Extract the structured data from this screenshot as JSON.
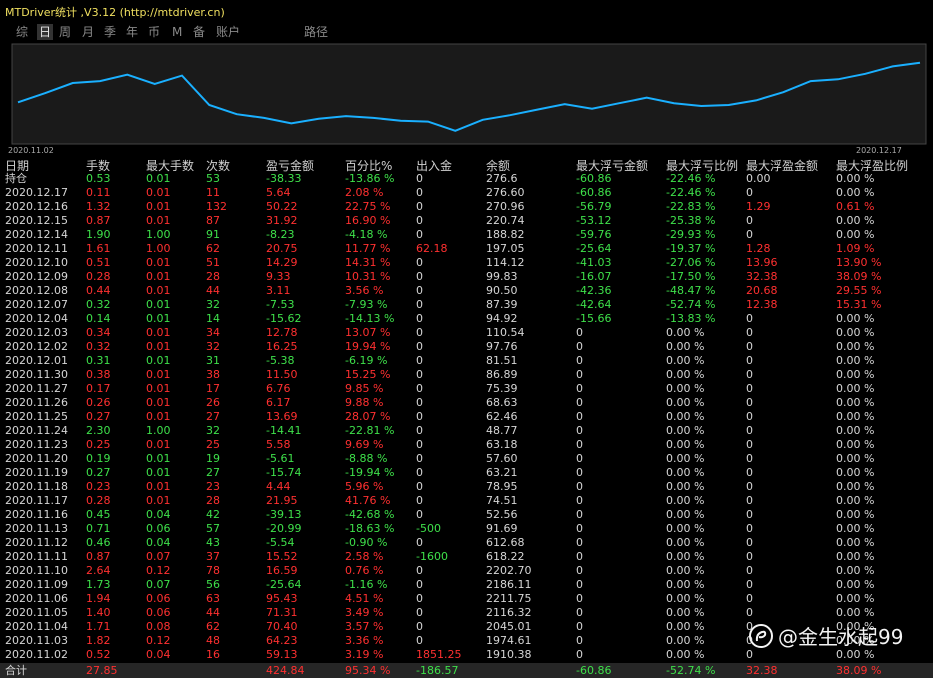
{
  "window": {
    "title": "MTDriver统计 ,V3.12 (http://mtdriver.cn)"
  },
  "tabs": [
    {
      "label": "综",
      "active": false
    },
    {
      "label": "日",
      "active": true
    },
    {
      "label": "周",
      "active": false
    },
    {
      "label": "月",
      "active": false
    },
    {
      "label": "季",
      "active": false
    },
    {
      "label": "年",
      "active": false
    },
    {
      "label": "币",
      "active": false
    },
    {
      "label": "M",
      "active": false
    },
    {
      "label": "备",
      "active": false
    },
    {
      "label": "账户",
      "active": false
    },
    {
      "label": "路径",
      "active": false
    }
  ],
  "chart": {
    "start_label": "2020.11.02",
    "end_label": "2020.12.17",
    "line_color": "#1ab0ff",
    "chart_data": {
      "type": "line",
      "x": [
        "2020.11.02",
        "2020.11.03",
        "2020.11.04",
        "2020.11.05",
        "2020.11.06",
        "2020.11.09",
        "2020.11.10",
        "2020.11.11",
        "2020.11.12",
        "2020.11.13",
        "2020.11.16",
        "2020.11.17",
        "2020.11.18",
        "2020.11.19",
        "2020.11.20",
        "2020.11.23",
        "2020.11.24",
        "2020.11.25",
        "2020.11.26",
        "2020.11.27",
        "2020.11.30",
        "2020.12.01",
        "2020.12.02",
        "2020.12.03",
        "2020.12.04",
        "2020.12.07",
        "2020.12.08",
        "2020.12.09",
        "2020.12.10",
        "2020.12.11",
        "2020.12.14",
        "2020.12.15",
        "2020.12.16",
        "2020.12.17"
      ],
      "y": [
        1910.38,
        1974.61,
        2045.01,
        2116.32,
        2211.75,
        2186.11,
        2202.7,
        618.22,
        612.68,
        91.69,
        52.56,
        74.51,
        78.95,
        63.21,
        57.6,
        63.18,
        48.77,
        62.46,
        68.63,
        75.39,
        86.89,
        81.51,
        97.76,
        110.54,
        94.92,
        87.39,
        90.5,
        99.83,
        114.12,
        197.05,
        188.82,
        220.74,
        270.96,
        276.6
      ]
    },
    "display_values": [
      41,
      51,
      62,
      64,
      71,
      61,
      70,
      38,
      28,
      24,
      18,
      23,
      26,
      24,
      21,
      20,
      10,
      22,
      27,
      33,
      39,
      34,
      40,
      46,
      40,
      37,
      38,
      43,
      52,
      64,
      66,
      72,
      80,
      84
    ]
  },
  "table": {
    "headers": [
      "日期",
      "手数",
      "最大手数",
      "次数",
      "盈亏金额",
      "百分比%",
      "出入金",
      "余额",
      "最大浮亏金额",
      "最大浮亏比例",
      "最大浮盈金额",
      "最大浮盈比例"
    ],
    "position_row": {
      "date": "持仓",
      "lots": "0.53",
      "maxlots": "0.01",
      "count": "53",
      "pl": "-38.33",
      "pct": "-13.86 %",
      "flow": "0",
      "balance": "276.6",
      "maxloss": "-60.86",
      "maxlosspct": "-22.46 %",
      "maxprofit": "0.00",
      "maxprofitpct": "0.00 %"
    },
    "rows": [
      {
        "date": "2020.12.17",
        "lots": "0.11",
        "maxlots": "0.01",
        "count": "11",
        "pl": "5.64",
        "pct": "2.08 %",
        "flow": "0",
        "balance": "276.60",
        "maxloss": "-60.86",
        "maxlosspct": "-22.46 %",
        "maxprofit": "0",
        "maxprofitpct": "0.00 %"
      },
      {
        "date": "2020.12.16",
        "lots": "1.32",
        "maxlots": "0.01",
        "count": "132",
        "pl": "50.22",
        "pct": "22.75 %",
        "flow": "0",
        "balance": "270.96",
        "maxloss": "-56.79",
        "maxlosspct": "-22.83 %",
        "maxprofit": "1.29",
        "maxprofitpct": "0.61 %"
      },
      {
        "date": "2020.12.15",
        "lots": "0.87",
        "maxlots": "0.01",
        "count": "87",
        "pl": "31.92",
        "pct": "16.90 %",
        "flow": "0",
        "balance": "220.74",
        "maxloss": "-53.12",
        "maxlosspct": "-25.38 %",
        "maxprofit": "0",
        "maxprofitpct": "0.00 %"
      },
      {
        "date": "2020.12.14",
        "lots": "1.90",
        "maxlots": "1.00",
        "count": "91",
        "pl": "-8.23",
        "pct": "-4.18 %",
        "flow": "0",
        "balance": "188.82",
        "maxloss": "-59.76",
        "maxlosspct": "-29.93 %",
        "maxprofit": "0",
        "maxprofitpct": "0.00 %"
      },
      {
        "date": "2020.12.11",
        "lots": "1.61",
        "maxlots": "1.00",
        "count": "62",
        "pl": "20.75",
        "pct": "11.77 %",
        "flow": "62.18",
        "balance": "197.05",
        "maxloss": "-25.64",
        "maxlosspct": "-19.37 %",
        "maxprofit": "1.28",
        "maxprofitpct": "1.09 %"
      },
      {
        "date": "2020.12.10",
        "lots": "0.51",
        "maxlots": "0.01",
        "count": "51",
        "pl": "14.29",
        "pct": "14.31 %",
        "flow": "0",
        "balance": "114.12",
        "maxloss": "-41.03",
        "maxlosspct": "-27.06 %",
        "maxprofit": "13.96",
        "maxprofitpct": "13.90 %"
      },
      {
        "date": "2020.12.09",
        "lots": "0.28",
        "maxlots": "0.01",
        "count": "28",
        "pl": "9.33",
        "pct": "10.31 %",
        "flow": "0",
        "balance": "99.83",
        "maxloss": "-16.07",
        "maxlosspct": "-17.50 %",
        "maxprofit": "32.38",
        "maxprofitpct": "38.09 %"
      },
      {
        "date": "2020.12.08",
        "lots": "0.44",
        "maxlots": "0.01",
        "count": "44",
        "pl": "3.11",
        "pct": "3.56 %",
        "flow": "0",
        "balance": "90.50",
        "maxloss": "-42.36",
        "maxlosspct": "-48.47 %",
        "maxprofit": "20.68",
        "maxprofitpct": "29.55 %"
      },
      {
        "date": "2020.12.07",
        "lots": "0.32",
        "maxlots": "0.01",
        "count": "32",
        "pl": "-7.53",
        "pct": "-7.93 %",
        "flow": "0",
        "balance": "87.39",
        "maxloss": "-42.64",
        "maxlosspct": "-52.74 %",
        "maxprofit": "12.38",
        "maxprofitpct": "15.31 %"
      },
      {
        "date": "2020.12.04",
        "lots": "0.14",
        "maxlots": "0.01",
        "count": "14",
        "pl": "-15.62",
        "pct": "-14.13 %",
        "flow": "0",
        "balance": "94.92",
        "maxloss": "-15.66",
        "maxlosspct": "-13.83 %",
        "maxprofit": "0",
        "maxprofitpct": "0.00 %"
      },
      {
        "date": "2020.12.03",
        "lots": "0.34",
        "maxlots": "0.01",
        "count": "34",
        "pl": "12.78",
        "pct": "13.07 %",
        "flow": "0",
        "balance": "110.54",
        "maxloss": "0",
        "maxlosspct": "0.00 %",
        "maxprofit": "0",
        "maxprofitpct": "0.00 %"
      },
      {
        "date": "2020.12.02",
        "lots": "0.32",
        "maxlots": "0.01",
        "count": "32",
        "pl": "16.25",
        "pct": "19.94 %",
        "flow": "0",
        "balance": "97.76",
        "maxloss": "0",
        "maxlosspct": "0.00 %",
        "maxprofit": "0",
        "maxprofitpct": "0.00 %"
      },
      {
        "date": "2020.12.01",
        "lots": "0.31",
        "maxlots": "0.01",
        "count": "31",
        "pl": "-5.38",
        "pct": "-6.19 %",
        "flow": "0",
        "balance": "81.51",
        "maxloss": "0",
        "maxlosspct": "0.00 %",
        "maxprofit": "0",
        "maxprofitpct": "0.00 %"
      },
      {
        "date": "2020.11.30",
        "lots": "0.38",
        "maxlots": "0.01",
        "count": "38",
        "pl": "11.50",
        "pct": "15.25 %",
        "flow": "0",
        "balance": "86.89",
        "maxloss": "0",
        "maxlosspct": "0.00 %",
        "maxprofit": "0",
        "maxprofitpct": "0.00 %"
      },
      {
        "date": "2020.11.27",
        "lots": "0.17",
        "maxlots": "0.01",
        "count": "17",
        "pl": "6.76",
        "pct": "9.85 %",
        "flow": "0",
        "balance": "75.39",
        "maxloss": "0",
        "maxlosspct": "0.00 %",
        "maxprofit": "0",
        "maxprofitpct": "0.00 %"
      },
      {
        "date": "2020.11.26",
        "lots": "0.26",
        "maxlots": "0.01",
        "count": "26",
        "pl": "6.17",
        "pct": "9.88 %",
        "flow": "0",
        "balance": "68.63",
        "maxloss": "0",
        "maxlosspct": "0.00 %",
        "maxprofit": "0",
        "maxprofitpct": "0.00 %"
      },
      {
        "date": "2020.11.25",
        "lots": "0.27",
        "maxlots": "0.01",
        "count": "27",
        "pl": "13.69",
        "pct": "28.07 %",
        "flow": "0",
        "balance": "62.46",
        "maxloss": "0",
        "maxlosspct": "0.00 %",
        "maxprofit": "0",
        "maxprofitpct": "0.00 %"
      },
      {
        "date": "2020.11.24",
        "lots": "2.30",
        "maxlots": "1.00",
        "count": "32",
        "pl": "-14.41",
        "pct": "-22.81 %",
        "flow": "0",
        "balance": "48.77",
        "maxloss": "0",
        "maxlosspct": "0.00 %",
        "maxprofit": "0",
        "maxprofitpct": "0.00 %"
      },
      {
        "date": "2020.11.23",
        "lots": "0.25",
        "maxlots": "0.01",
        "count": "25",
        "pl": "5.58",
        "pct": "9.69 %",
        "flow": "0",
        "balance": "63.18",
        "maxloss": "0",
        "maxlosspct": "0.00 %",
        "maxprofit": "0",
        "maxprofitpct": "0.00 %"
      },
      {
        "date": "2020.11.20",
        "lots": "0.19",
        "maxlots": "0.01",
        "count": "19",
        "pl": "-5.61",
        "pct": "-8.88 %",
        "flow": "0",
        "balance": "57.60",
        "maxloss": "0",
        "maxlosspct": "0.00 %",
        "maxprofit": "0",
        "maxprofitpct": "0.00 %"
      },
      {
        "date": "2020.11.19",
        "lots": "0.27",
        "maxlots": "0.01",
        "count": "27",
        "pl": "-15.74",
        "pct": "-19.94 %",
        "flow": "0",
        "balance": "63.21",
        "maxloss": "0",
        "maxlosspct": "0.00 %",
        "maxprofit": "0",
        "maxprofitpct": "0.00 %"
      },
      {
        "date": "2020.11.18",
        "lots": "0.23",
        "maxlots": "0.01",
        "count": "23",
        "pl": "4.44",
        "pct": "5.96 %",
        "flow": "0",
        "balance": "78.95",
        "maxloss": "0",
        "maxlosspct": "0.00 %",
        "maxprofit": "0",
        "maxprofitpct": "0.00 %"
      },
      {
        "date": "2020.11.17",
        "lots": "0.28",
        "maxlots": "0.01",
        "count": "28",
        "pl": "21.95",
        "pct": "41.76 %",
        "flow": "0",
        "balance": "74.51",
        "maxloss": "0",
        "maxlosspct": "0.00 %",
        "maxprofit": "0",
        "maxprofitpct": "0.00 %"
      },
      {
        "date": "2020.11.16",
        "lots": "0.45",
        "maxlots": "0.04",
        "count": "42",
        "pl": "-39.13",
        "pct": "-42.68 %",
        "flow": "0",
        "balance": "52.56",
        "maxloss": "0",
        "maxlosspct": "0.00 %",
        "maxprofit": "0",
        "maxprofitpct": "0.00 %"
      },
      {
        "date": "2020.11.13",
        "lots": "0.71",
        "maxlots": "0.06",
        "count": "57",
        "pl": "-20.99",
        "pct": "-18.63 %",
        "flow": "-500",
        "balance": "91.69",
        "maxloss": "0",
        "maxlosspct": "0.00 %",
        "maxprofit": "0",
        "maxprofitpct": "0.00 %"
      },
      {
        "date": "2020.11.12",
        "lots": "0.46",
        "maxlots": "0.04",
        "count": "43",
        "pl": "-5.54",
        "pct": "-0.90 %",
        "flow": "0",
        "balance": "612.68",
        "maxloss": "0",
        "maxlosspct": "0.00 %",
        "maxprofit": "0",
        "maxprofitpct": "0.00 %"
      },
      {
        "date": "2020.11.11",
        "lots": "0.87",
        "maxlots": "0.07",
        "count": "37",
        "pl": "15.52",
        "pct": "2.58 %",
        "flow": "-1600",
        "balance": "618.22",
        "maxloss": "0",
        "maxlosspct": "0.00 %",
        "maxprofit": "0",
        "maxprofitpct": "0.00 %"
      },
      {
        "date": "2020.11.10",
        "lots": "2.64",
        "maxlots": "0.12",
        "count": "78",
        "pl": "16.59",
        "pct": "0.76 %",
        "flow": "0",
        "balance": "2202.70",
        "maxloss": "0",
        "maxlosspct": "0.00 %",
        "maxprofit": "0",
        "maxprofitpct": "0.00 %"
      },
      {
        "date": "2020.11.09",
        "lots": "1.73",
        "maxlots": "0.07",
        "count": "56",
        "pl": "-25.64",
        "pct": "-1.16 %",
        "flow": "0",
        "balance": "2186.11",
        "maxloss": "0",
        "maxlosspct": "0.00 %",
        "maxprofit": "0",
        "maxprofitpct": "0.00 %"
      },
      {
        "date": "2020.11.06",
        "lots": "1.94",
        "maxlots": "0.06",
        "count": "63",
        "pl": "95.43",
        "pct": "4.51 %",
        "flow": "0",
        "balance": "2211.75",
        "maxloss": "0",
        "maxlosspct": "0.00 %",
        "maxprofit": "0",
        "maxprofitpct": "0.00 %"
      },
      {
        "date": "2020.11.05",
        "lots": "1.40",
        "maxlots": "0.06",
        "count": "44",
        "pl": "71.31",
        "pct": "3.49 %",
        "flow": "0",
        "balance": "2116.32",
        "maxloss": "0",
        "maxlosspct": "0.00 %",
        "maxprofit": "0",
        "maxprofitpct": "0.00 %"
      },
      {
        "date": "2020.11.04",
        "lots": "1.71",
        "maxlots": "0.08",
        "count": "62",
        "pl": "70.40",
        "pct": "3.57 %",
        "flow": "0",
        "balance": "2045.01",
        "maxloss": "0",
        "maxlosspct": "0.00 %",
        "maxprofit": "0",
        "maxprofitpct": "0.00 %"
      },
      {
        "date": "2020.11.03",
        "lots": "1.82",
        "maxlots": "0.12",
        "count": "48",
        "pl": "64.23",
        "pct": "3.36 %",
        "flow": "0",
        "balance": "1974.61",
        "maxloss": "0",
        "maxlosspct": "0.00 %",
        "maxprofit": "0",
        "maxprofitpct": "0.00 %"
      },
      {
        "date": "2020.11.02",
        "lots": "0.52",
        "maxlots": "0.04",
        "count": "16",
        "pl": "59.13",
        "pct": "3.19 %",
        "flow": "1851.25",
        "balance": "1910.38",
        "maxloss": "0",
        "maxlosspct": "0.00 %",
        "maxprofit": "0",
        "maxprofitpct": "0.00 %"
      }
    ],
    "total_row": {
      "date": "合计",
      "lots": "27.85",
      "maxlots": "",
      "count": "",
      "pl": "424.84",
      "pct": "95.34 %",
      "flow": "-186.57",
      "balance": "",
      "maxloss": "-60.86",
      "maxlosspct": "-52.74 %",
      "maxprofit": "32.38",
      "maxprofitpct": "38.09 %"
    }
  },
  "watermark": {
    "icon": "weibo-icon",
    "text": "@金生水起99"
  },
  "colors": {
    "positive": "#ff3030",
    "negative": "#3ee04a",
    "neutral": "#d6d6d6",
    "line": "#1ab0ff",
    "tab_active": "#333333"
  }
}
